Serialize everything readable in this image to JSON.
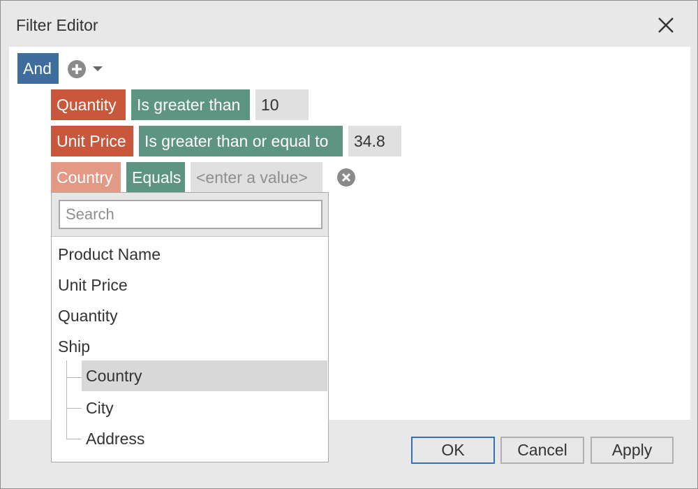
{
  "window": {
    "title": "Filter Editor"
  },
  "group": {
    "label": "And"
  },
  "conditions": [
    {
      "field": "Quantity",
      "operator": "Is greater than",
      "value": "10"
    },
    {
      "field": "Unit Price",
      "operator": "Is greater than or equal to",
      "value": "34.8"
    },
    {
      "field": "Country",
      "operator": "Equals",
      "value_placeholder": "<enter a value>"
    }
  ],
  "field_picker": {
    "search_placeholder": "Search",
    "items": [
      "Product Name",
      "Unit Price",
      "Quantity",
      "Ship"
    ],
    "ship_children": [
      "Country",
      "City",
      "Address"
    ],
    "selected": "Country"
  },
  "buttons": {
    "ok": "OK",
    "cancel": "Cancel",
    "apply": "Apply"
  },
  "colors": {
    "group": "#3f6e9c",
    "field": "#c9573b",
    "field_active": "#e29a86",
    "operator": "#5e9482",
    "value": "#e0e0e0",
    "accent": "#2f72c4"
  },
  "icons": {
    "close": "close-icon",
    "add": "plus-circle-icon",
    "dropdown": "chevron-down-icon",
    "remove": "remove-circle-icon"
  }
}
